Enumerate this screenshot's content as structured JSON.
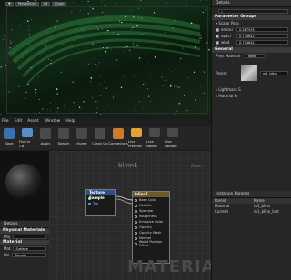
{
  "viewport": {
    "buttons": [
      "",
      "Perspective",
      "Lit",
      "Show"
    ],
    "star_pattern_color": "#ffffff",
    "aurora_color": "#3aa84a"
  },
  "details": {
    "tab_label": "Details",
    "search_placeholder": "Search",
    "parameter_groups_label": "Parameter Groups",
    "scalar_group_label": "Scalar Para",
    "scalars": [
      {
        "name": "emissi",
        "value": "0.587535"
      },
      {
        "name": "opaci",
        "value": "0.774642"
      },
      {
        "name": "wind",
        "value": "0.774642"
      }
    ],
    "general_label": "General",
    "phys_material_label": "Phys Material",
    "phys_material_value": "None",
    "parent_label": "Parent",
    "parent_value": "m1_blinn",
    "lightmass_label": "Lightmass S",
    "material_label": "Material Pr"
  },
  "menubar": [
    "File",
    "Edit",
    "Asset",
    "Window",
    "Help"
  ],
  "toolbar": [
    {
      "label": "Save",
      "color": "#3c6fb0"
    },
    {
      "label": "Find in CB",
      "color": "#5a8cc8"
    },
    {
      "label": "Apply",
      "color": "#4a4a4a"
    },
    {
      "label": "Search",
      "color": "#4a4a4a"
    },
    {
      "label": "Home",
      "color": "#4a4a4a"
    },
    {
      "label": "Clean Up",
      "color": "#4a4a4a"
    },
    {
      "label": "Connectors",
      "color": "#d07a2a"
    },
    {
      "label": "Live Preview",
      "color": "#e8a030"
    },
    {
      "label": "Live Nodes",
      "color": "#4a4a4a"
    },
    {
      "label": "Live Update",
      "color": "#4a4a4a"
    }
  ],
  "graph": {
    "title": "blinn1",
    "zoom": "Zoom",
    "watermark": "MATERIAL",
    "texture_node": {
      "title": "Texture Sample",
      "pins": [
        "UVs",
        "Tex"
      ]
    },
    "material_node": {
      "title": "blinn1",
      "pins": [
        "Base Color",
        "Metallic",
        "Specular",
        "Roughness",
        "Emissive Color",
        "Opacity",
        "Opacity Mask",
        "Normal",
        "World Position Offset"
      ]
    }
  },
  "props": {
    "tab_label": "Details",
    "section_label": "Physical Materials",
    "phys_label": "Phy",
    "section2_label": "Material",
    "mat_label": "Mat",
    "mat_value": "Surface",
    "blend_label": "Ble",
    "blend_value": "Translu"
  },
  "params": {
    "tab_label": "Instance Parents",
    "col_parent": "Parent",
    "col_name": "Name",
    "rows": [
      {
        "parent": "Material",
        "name": "m1_blinn"
      },
      {
        "parent": "Current",
        "name": "m1_blinn_Inst"
      }
    ]
  }
}
